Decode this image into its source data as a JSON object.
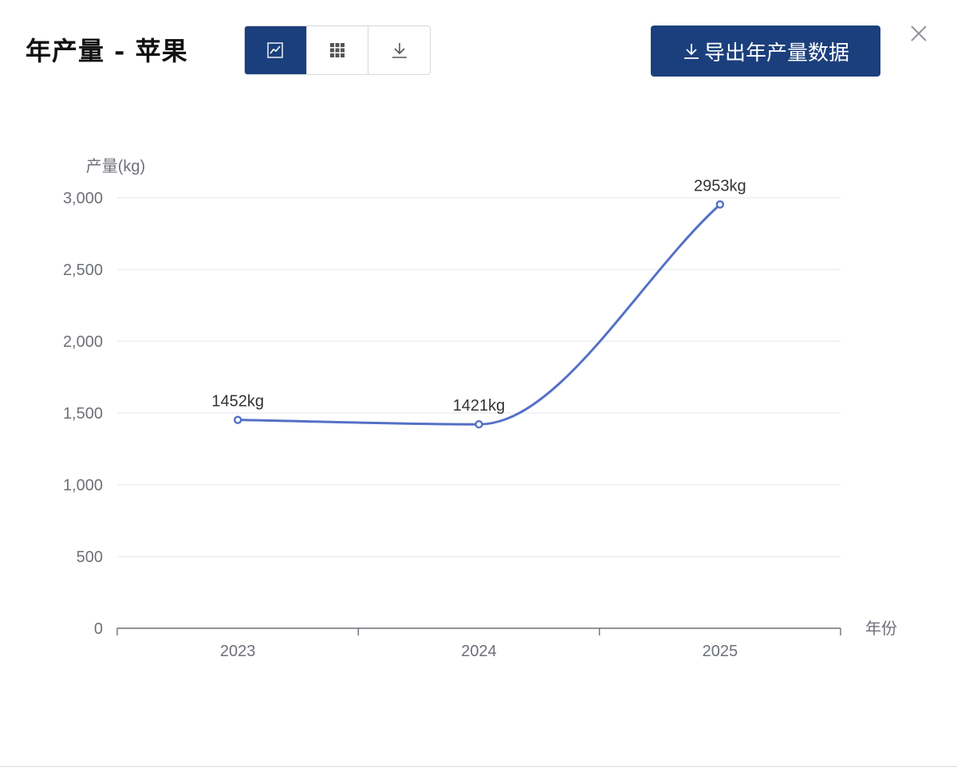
{
  "dialog": {
    "title": "年产量 - 苹果",
    "export_label": "导出年产量数据",
    "icons": {
      "chart_view": "line-chart-icon",
      "table_view": "grid-icon",
      "download": "download-icon",
      "close": "close-icon",
      "export": "download-icon"
    }
  },
  "colors": {
    "primary": "#1b3f7c",
    "series": "#5470c6",
    "grid": "#e0e6f1",
    "axis": "#6e7079"
  },
  "chart_data": {
    "type": "line",
    "smooth": true,
    "ylabel": "产量(kg)",
    "xlabel": "年份",
    "categories": [
      "2023",
      "2024",
      "2025"
    ],
    "series": [
      {
        "values": [
          1452,
          1421,
          2953
        ],
        "data_labels": [
          "1452kg",
          "1421kg",
          "2953kg"
        ]
      }
    ],
    "ylim": [
      0,
      3000
    ],
    "y_ticks": [
      0,
      500,
      1000,
      1500,
      2000,
      2500,
      3000
    ],
    "y_tick_labels": [
      "0",
      "500",
      "1,000",
      "1,500",
      "2,000",
      "2,500",
      "3,000"
    ],
    "grid": true,
    "legend": "none"
  }
}
